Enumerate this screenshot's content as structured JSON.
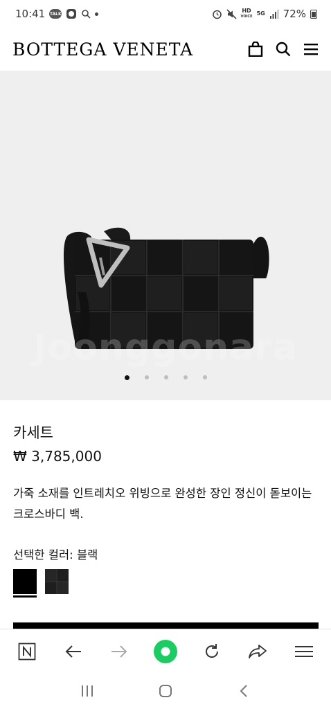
{
  "status_bar": {
    "time": "10:41",
    "talk_badge": "TALK",
    "hd_label": "HD",
    "volte_label": "VOICE",
    "network_label": "5G",
    "battery_percent": "72%"
  },
  "header": {
    "brand": "BOTTEGA VENETA",
    "icons": [
      "shopping-bag-icon",
      "search-icon",
      "menu-icon"
    ]
  },
  "product": {
    "watermark": "Joonggonara",
    "carousel": {
      "total": 5,
      "active": 1
    },
    "name": "카세트",
    "price": "₩ 3,785,000",
    "description": "가죽 소재를 인트레치오 위빙으로 완성한 장인 정신이 돋보이는 크로스바디 백.",
    "color_label": "선택한 컬러: 블랙",
    "swatches": [
      {
        "name": "블랙",
        "color": "#000000",
        "selected": true
      },
      {
        "name": "dark",
        "color": "#1e1e1e",
        "selected": false
      }
    ]
  },
  "browser_toolbar": {
    "icons": [
      "naver-n-icon",
      "back-arrow-icon",
      "forward-arrow-icon",
      "green-circle-icon",
      "refresh-icon",
      "share-icon",
      "hamburger-menu-icon"
    ],
    "accent_color": "#19ce60"
  },
  "system_nav": {
    "icons": [
      "recent-apps-icon",
      "home-icon",
      "back-icon"
    ]
  }
}
